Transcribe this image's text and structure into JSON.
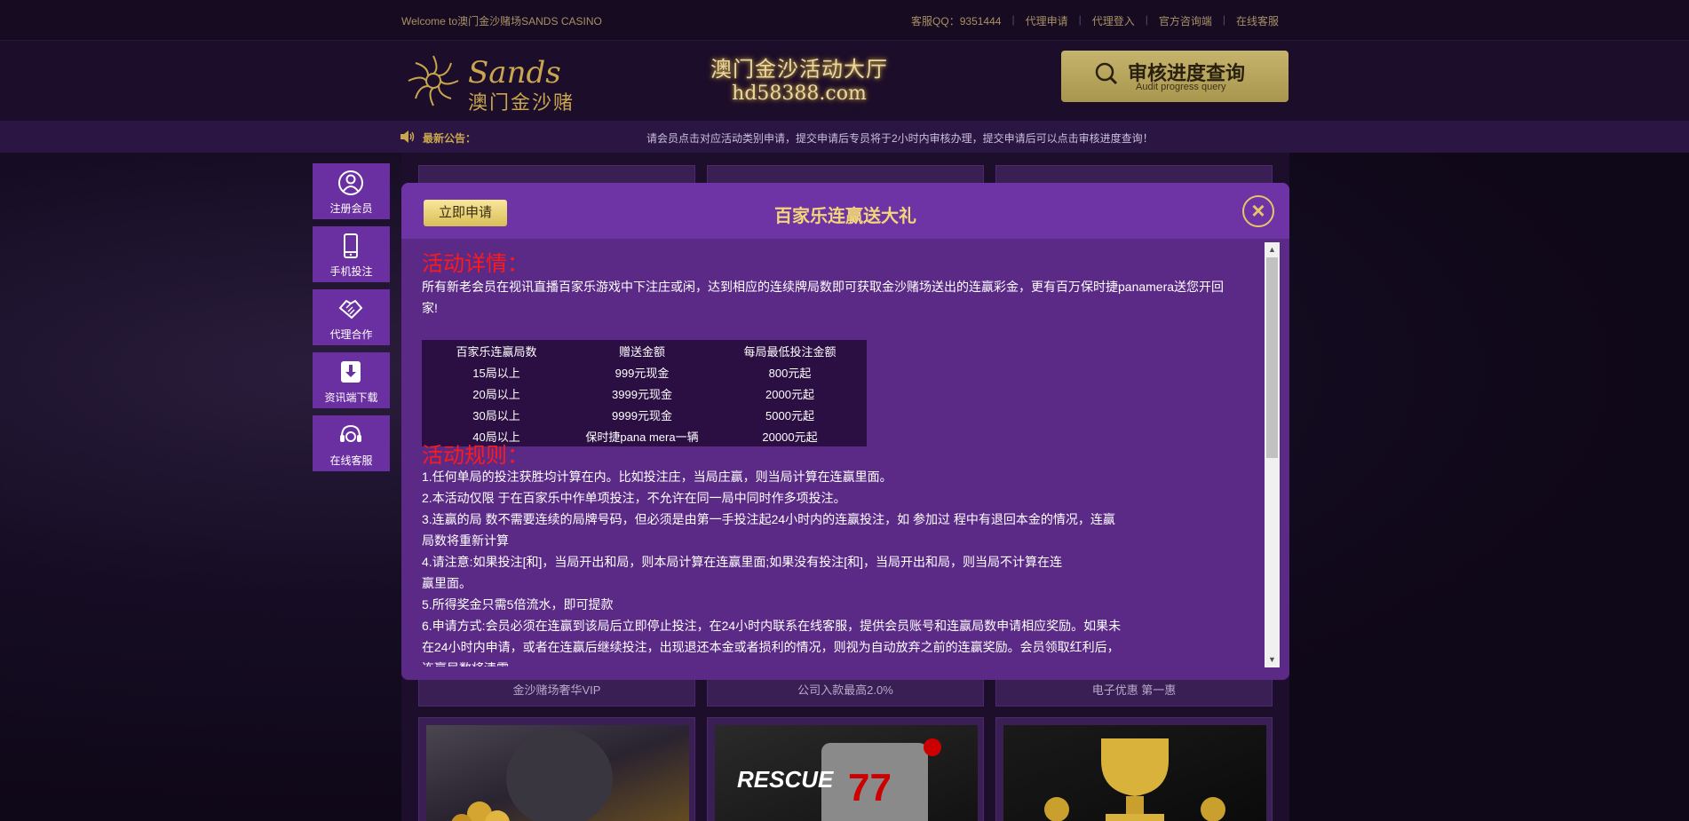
{
  "topbar": {
    "welcome": "Welcome to澳门金沙赌场SANDS CASINO",
    "links": [
      "客服QQ：9351444",
      "代理申请",
      "代理登入",
      "官方咨询端",
      "在线客服"
    ]
  },
  "header": {
    "logo_text": "Sands",
    "logo_sub": "澳门金沙赌场",
    "hall_title": "澳门金沙活动大厅",
    "hall_url": "hd58388.com",
    "audit_title": "审核进度查询",
    "audit_sub": "Audit progress query"
  },
  "notice": {
    "label": "最新公告：",
    "text": "请会员点击对应活动类别申请，提交申请后专员将于2小时内审核办理，提交申请后可以点击审核进度查询！"
  },
  "sidenav": [
    {
      "label": "注册会员",
      "icon": "user-icon"
    },
    {
      "label": "手机投注",
      "icon": "mobile-icon"
    },
    {
      "label": "代理合作",
      "icon": "handshake-icon"
    },
    {
      "label": "资讯端下载",
      "icon": "download-icon"
    },
    {
      "label": "在线客服",
      "icon": "headset-icon"
    }
  ],
  "cards": [
    {
      "caption": "金沙赌场奢华VIP"
    },
    {
      "caption": "公司入款最高2.0%"
    },
    {
      "caption": "电子优惠 第一惠"
    }
  ],
  "modal": {
    "apply_label": "立即申请",
    "title": "百家乐连赢送大礼",
    "close_label": "×",
    "details_title": "活动详情：",
    "details_text": "所有新老会员在视讯直播百家乐游戏中下注庄或闲，达到相应的连续牌局数即可获取金沙赌场送出的连赢彩金，更有百万保时捷panamera送您开回家!",
    "table": {
      "headers": [
        "百家乐连赢局数",
        "赠送金额",
        "每局最低投注金额"
      ],
      "rows": [
        [
          "15局以上",
          "999元现金",
          "800元起"
        ],
        [
          "20局以上",
          "3999元现金",
          "2000元起"
        ],
        [
          "30局以上",
          "9999元现金",
          "5000元起"
        ],
        [
          "40局以上",
          "保时捷pana mera一辆",
          "20000元起"
        ]
      ]
    },
    "rules_title": "活动规则：",
    "rules": [
      "1.任何单局的投注获胜均计算在内。比如投注庄，当局庄赢，则当局计算在连赢里面。",
      "2.本活动仅限 于在百家乐中作单项投注，不允许在同一局中同时作多项投注。",
      "3.连赢的局 数不需要连续的局牌号码，但必须是由第一手投注起24小时内的连赢投注，如 参加过 程中有退回本金的情况，连赢局数将重新计算",
      "4.请注意:如果投注[和]，当局开出和局，则本局计算在连赢里面;如果没有投注[和]，当局开出和局，则当局不计算在连赢里面。",
      "5.所得奖金只需5倍流水，即可提款",
      "6.申请方式:会员必须在连赢到该局后立即停止投注，在24小时内联系在线客服，提供会员账号和连赢局数申请相应奖励。如果未在24小时内申请，或者在连赢后继续投注，出现退还本金或者损利的情况，则视为自动放弃之前的连赢奖励。会员领取红利后，连赢局数将清零。"
    ]
  },
  "colors": {
    "accent_gold": "#c9a64e",
    "nav_purple": "#6a2fa0",
    "section_red": "#ff1a1a"
  }
}
